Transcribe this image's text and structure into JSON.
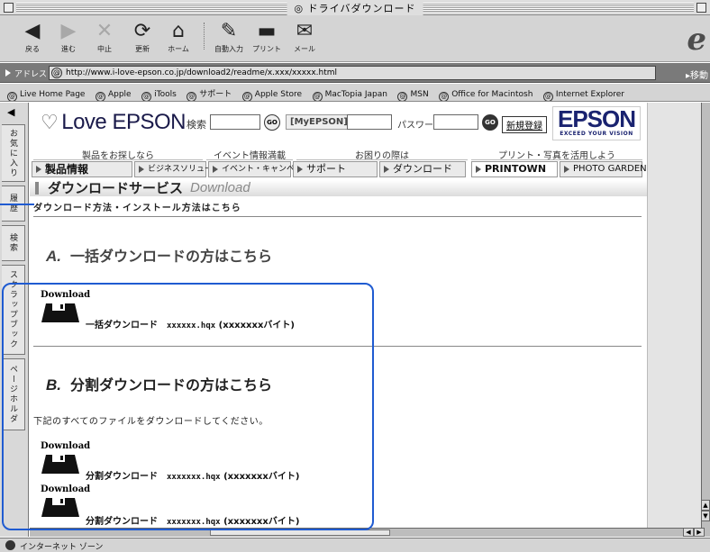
{
  "window": {
    "title": "ドライバダウンロード"
  },
  "toolbar": {
    "buttons": [
      {
        "label": "戻る",
        "icon": "back-arrow-icon"
      },
      {
        "label": "進む",
        "icon": "forward-arrow-icon"
      },
      {
        "label": "中止",
        "icon": "stop-x-icon"
      },
      {
        "label": "更新",
        "icon": "refresh-icon"
      },
      {
        "label": "ホーム",
        "icon": "home-icon"
      },
      {
        "label": "自動入力",
        "icon": "autofill-icon"
      },
      {
        "label": "プリント",
        "icon": "printer-icon"
      },
      {
        "label": "メール",
        "icon": "mail-icon"
      }
    ]
  },
  "address": {
    "label": "アドレス :",
    "url": "http://www.i-love-epson.co.jp/download2/readme/x.xxx/xxxxx.html",
    "go_label": "移動"
  },
  "favorites": [
    "Live Home Page",
    "Apple",
    "iTools",
    "サポート",
    "Apple Store",
    "MacTopia Japan",
    "MSN",
    "Office for Macintosh",
    "Internet Explorer"
  ],
  "sidetabs": [
    "お気に入り",
    "履歴",
    "検索",
    "スクラップブック",
    "ページホルダ"
  ],
  "header": {
    "logo_text": "Love EPSON",
    "search_label": "検索",
    "go_label": "GO",
    "myepson_label": "[MyEPSON] ID",
    "password_label": "パスワード",
    "register_label": "新規登録",
    "brand": "EPSON",
    "brand_tagline": "EXCEED YOUR VISION"
  },
  "nav": {
    "top_labels": [
      "製品をお探しなら",
      "イベント情報満載",
      "お困りの際は",
      "プリント・写真を活用しよう"
    ],
    "buttons": [
      "製品情報",
      "ビジネスソリューション",
      "イベント・キャンペーン",
      "サポート",
      "ダウンロード",
      "PRINTOWN",
      "PHOTO GARDEN"
    ]
  },
  "service": {
    "title_jp": "ダウンロードサービス",
    "title_en": "Download"
  },
  "page": {
    "howto_text": "ダウンロード方法・インストール方法はこちら",
    "section_a": {
      "letter": "A.",
      "title": "一括ダウンロードの方はこちら"
    },
    "section_b": {
      "letter": "B.",
      "title": "分割ダウンロードの方はこちら"
    },
    "note": "下記のすべてのファイルをダウンロードしてください。",
    "download_label": "Download",
    "downloads_a": [
      {
        "name": "一括ダウンロード",
        "file": "xxxxxx.hqx",
        "size": "(xxxxxxxバイト)"
      }
    ],
    "downloads_b": [
      {
        "name": "分割ダウンロード",
        "file": "xxxxxxx.hqx",
        "size": "(xxxxxxxバイト)"
      },
      {
        "name": "分割ダウンロード",
        "file": "xxxxxxx.hqx",
        "size": "(xxxxxxxバイト)"
      }
    ]
  },
  "status": {
    "text": "インターネット ゾーン"
  },
  "colors": {
    "highlight": "#1f5bd1",
    "brand": "#1a2370"
  }
}
